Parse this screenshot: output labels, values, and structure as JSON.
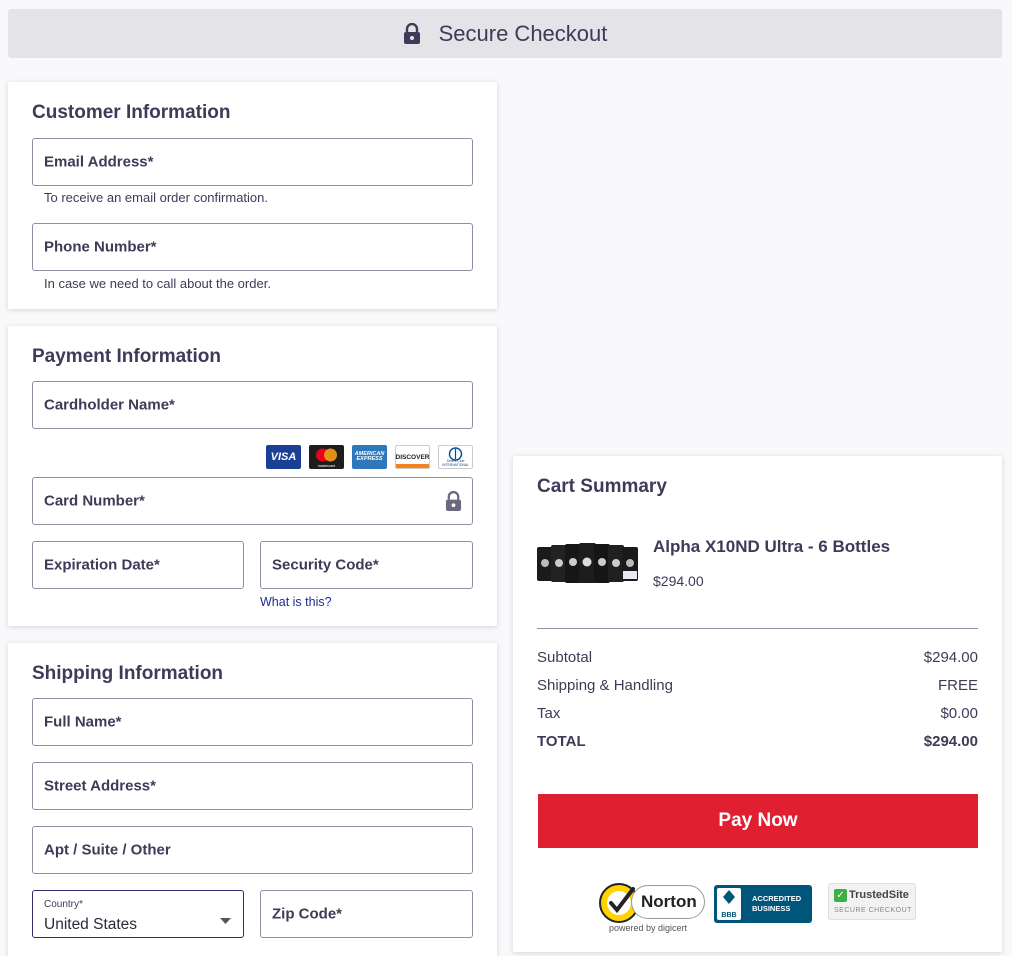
{
  "header": {
    "title": "Secure Checkout"
  },
  "customer": {
    "title": "Customer Information",
    "email_label": "Email Address*",
    "email_hint": "To receive an email order confirmation.",
    "phone_label": "Phone Number*",
    "phone_hint": "In case we need to call about the order."
  },
  "payment": {
    "title": "Payment Information",
    "cardholder_label": "Cardholder Name*",
    "cards": {
      "visa": "VISA",
      "amex": "AMERICAN EXPRESS",
      "discover": "DISCOVER",
      "mastercard_text": "mastercard",
      "diners_text": "Diners Club INTERNATIONAL"
    },
    "card_number_label": "Card Number*",
    "expiration_label": "Expiration Date*",
    "security_label": "Security Code*",
    "what_is_this": "What is this?"
  },
  "shipping": {
    "title": "Shipping Information",
    "full_name_label": "Full Name*",
    "street_label": "Street Address*",
    "apt_label": "Apt / Suite / Other",
    "country_label": "Country*",
    "country_value": "United States",
    "zip_label": "Zip Code*"
  },
  "cart": {
    "title": "Cart Summary",
    "product_name": "Alpha X10ND Ultra - 6 Bottles",
    "product_price": "$294.00",
    "subtotal_label": "Subtotal",
    "subtotal_value": "$294.00",
    "shipping_label": "Shipping & Handling",
    "shipping_value": "FREE",
    "tax_label": "Tax",
    "tax_value": "$0.00",
    "total_label": "TOTAL",
    "total_value": "$294.00",
    "pay_label": "Pay Now"
  },
  "badges": {
    "norton_name": "Norton",
    "norton_sub": "powered by digicert",
    "bbb_text": "BBB",
    "bbb_line1": "ACCREDITED",
    "bbb_line2": "BUSINESS",
    "trusted_name": "TrustedSite",
    "trusted_sub": "SECURE CHECKOUT"
  },
  "colors": {
    "accent": "#3d3b57",
    "pay_button": "#e02030",
    "link": "#1f2c8f"
  }
}
